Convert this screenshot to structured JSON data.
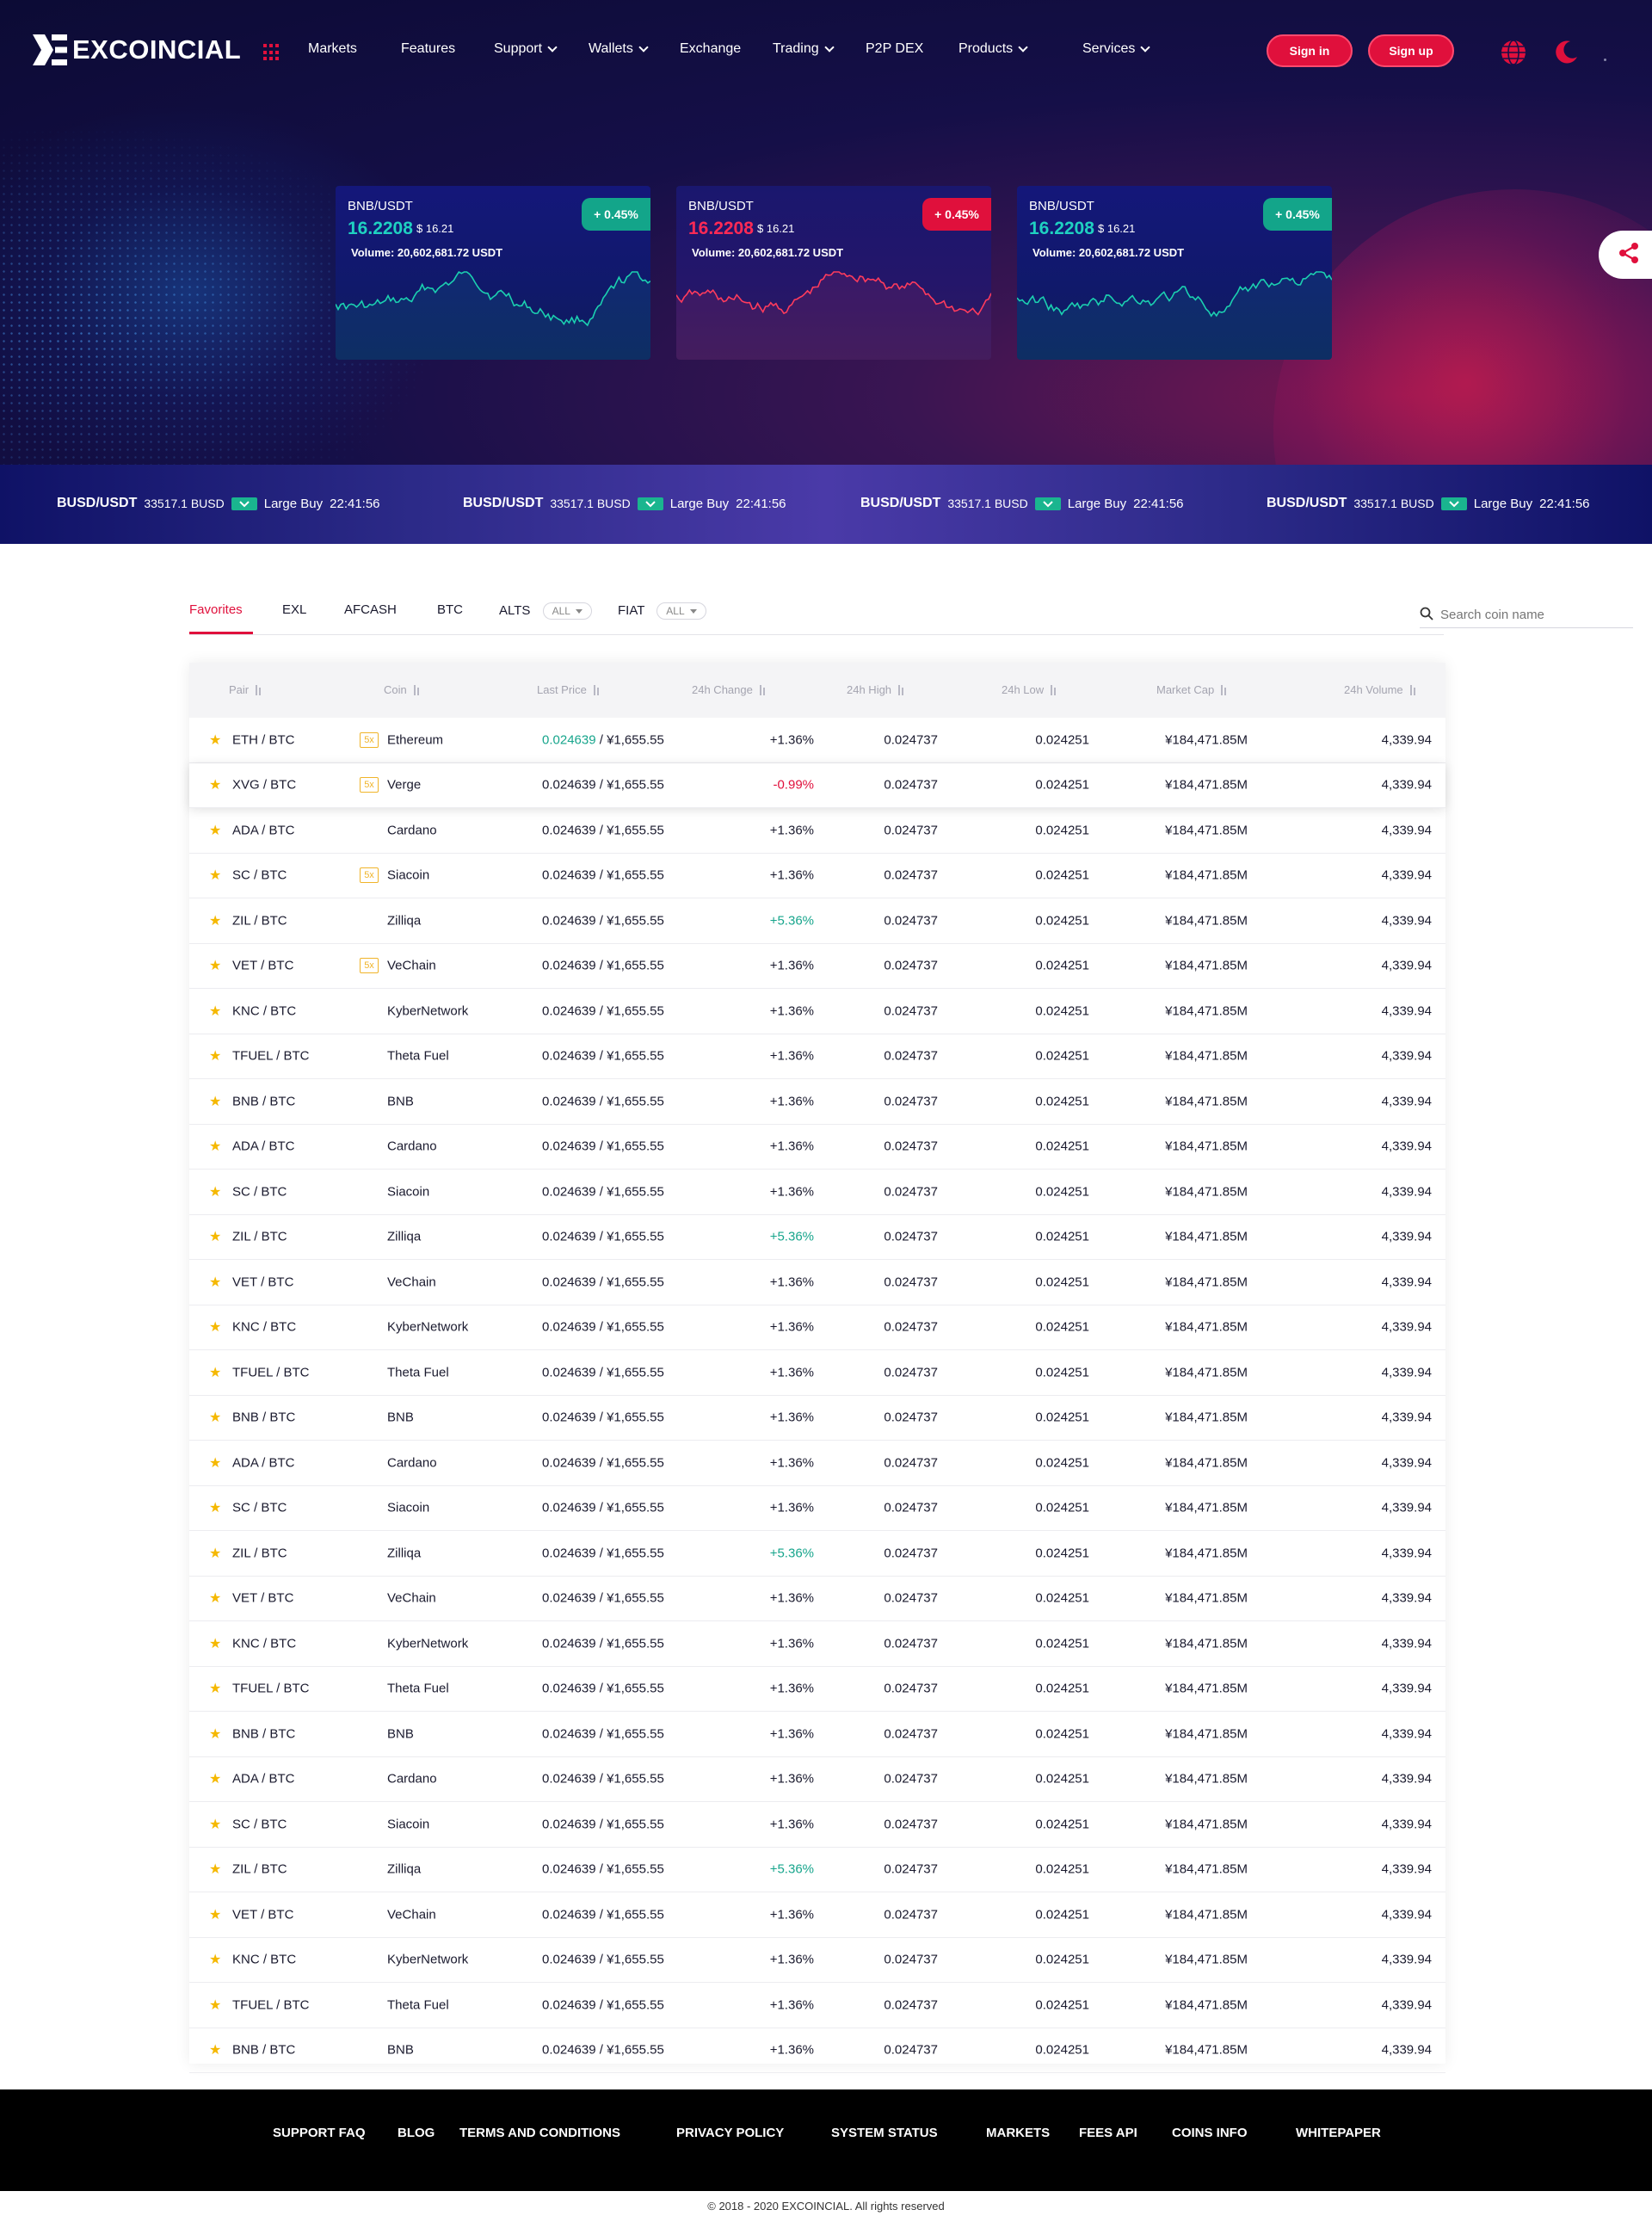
{
  "brand": {
    "name": "EXCOINCIAL"
  },
  "nav": {
    "items": [
      {
        "label": "Markets",
        "dropdown": false
      },
      {
        "label": "Features",
        "dropdown": false
      },
      {
        "label": "Support",
        "dropdown": true
      },
      {
        "label": "Wallets",
        "dropdown": true
      },
      {
        "label": "Exchange",
        "dropdown": false
      },
      {
        "label": "Trading",
        "dropdown": true
      },
      {
        "label": "P2P DEX",
        "dropdown": false
      },
      {
        "label": "Products",
        "dropdown": true
      },
      {
        "label": "Services",
        "dropdown": true
      }
    ],
    "sign_in": "Sign in",
    "sign_up": "Sign up"
  },
  "cards": [
    {
      "pair": "BNB/USDT",
      "price": "16.2208",
      "usd": "$ 16.21",
      "volume": "Volume: 20,602,681.72 USDT",
      "change": "+ 0.45%",
      "trend": "up",
      "price_color": "#1fd1c1",
      "badge_color": "#13a58a"
    },
    {
      "pair": "BNB/USDT",
      "price": "16.2208",
      "usd": "$ 16.21",
      "volume": "Volume: 20,602,681.72 USDT",
      "change": "+ 0.45%",
      "trend": "down",
      "price_color": "#ff2a55",
      "badge_color": "#e0103c"
    },
    {
      "pair": "BNB/USDT",
      "price": "16.2208",
      "usd": "$ 16.21",
      "volume": "Volume: 20,602,681.72 USDT",
      "change": "+ 0.45%",
      "trend": "up",
      "price_color": "#1fd1c1",
      "badge_color": "#13a58a"
    }
  ],
  "marquee": [
    {
      "pair": "BUSD/USDT",
      "value": "33517.1 BUSD",
      "type": "Large Buy",
      "time": "22:41:56"
    },
    {
      "pair": "BUSD/USDT",
      "value": "33517.1 BUSD",
      "type": "Large Buy",
      "time": "22:41:56"
    },
    {
      "pair": "BUSD/USDT",
      "value": "33517.1 BUSD",
      "type": "Large Buy",
      "time": "22:41:56"
    },
    {
      "pair": "BUSD/USDT",
      "value": "33517.1 BUSD",
      "type": "Large Buy",
      "time": "22:41:56"
    }
  ],
  "tabs": {
    "favorites": "Favorites",
    "exl": "EXL",
    "afcash": "AFCASH",
    "btc": "BTC",
    "alts": "ALTS",
    "fiat": "FIAT",
    "all": "ALL"
  },
  "search": {
    "placeholder": "Search coin name"
  },
  "table": {
    "headers": [
      "Pair",
      "Coin",
      "Last Price",
      "24h Change",
      "24h High",
      "24h Low",
      "Market Cap",
      "24h Volume"
    ],
    "rows": [
      {
        "pair": "ETH / BTC",
        "lev": "5x",
        "coin": "Ethereum",
        "last_hi": "0.024639",
        "last_rest": " / ¥1,655.55",
        "change": "+1.36%",
        "chg": "pos",
        "high": "0.024737",
        "low": "0.024251",
        "cap": "¥184,471.85M",
        "vol": "4,339.94"
      },
      {
        "pair": "XVG / BTC",
        "lev": "5x",
        "coin": "Verge",
        "last_hi": "",
        "last_rest": "0.024639 / ¥1,655.55",
        "change": "-0.99%",
        "chg": "red",
        "high": "0.024737",
        "low": "0.024251",
        "cap": "¥184,471.85M",
        "vol": "4,339.94",
        "hl": true
      },
      {
        "pair": "ADA / BTC",
        "lev": "",
        "coin": "Cardano",
        "last_hi": "",
        "last_rest": "0.024639 / ¥1,655.55",
        "change": "+1.36%",
        "chg": "pos",
        "high": "0.024737",
        "low": "0.024251",
        "cap": "¥184,471.85M",
        "vol": "4,339.94"
      },
      {
        "pair": "SC / BTC",
        "lev": "5x",
        "coin": "Siacoin",
        "last_hi": "",
        "last_rest": "0.024639 / ¥1,655.55",
        "change": "+1.36%",
        "chg": "pos",
        "high": "0.024737",
        "low": "0.024251",
        "cap": "¥184,471.85M",
        "vol": "4,339.94"
      },
      {
        "pair": "ZIL / BTC",
        "lev": "",
        "coin": "Zilliqa",
        "last_hi": "",
        "last_rest": "0.024639 / ¥1,655.55",
        "change": "+5.36%",
        "chg": "green",
        "high": "0.024737",
        "low": "0.024251",
        "cap": "¥184,471.85M",
        "vol": "4,339.94"
      },
      {
        "pair": "VET / BTC",
        "lev": "5x",
        "coin": "VeChain",
        "last_hi": "",
        "last_rest": "0.024639 / ¥1,655.55",
        "change": "+1.36%",
        "chg": "pos",
        "high": "0.024737",
        "low": "0.024251",
        "cap": "¥184,471.85M",
        "vol": "4,339.94"
      },
      {
        "pair": "KNC / BTC",
        "lev": "",
        "coin": "KyberNetwork",
        "last_hi": "",
        "last_rest": "0.024639 / ¥1,655.55",
        "change": "+1.36%",
        "chg": "pos",
        "high": "0.024737",
        "low": "0.024251",
        "cap": "¥184,471.85M",
        "vol": "4,339.94"
      },
      {
        "pair": "TFUEL / BTC",
        "lev": "",
        "coin": "Theta Fuel",
        "last_hi": "",
        "last_rest": "0.024639 / ¥1,655.55",
        "change": "+1.36%",
        "chg": "pos",
        "high": "0.024737",
        "low": "0.024251",
        "cap": "¥184,471.85M",
        "vol": "4,339.94"
      },
      {
        "pair": "BNB / BTC",
        "lev": "",
        "coin": "BNB",
        "last_hi": "",
        "last_rest": "0.024639 / ¥1,655.55",
        "change": "+1.36%",
        "chg": "pos",
        "high": "0.024737",
        "low": "0.024251",
        "cap": "¥184,471.85M",
        "vol": "4,339.94"
      },
      {
        "pair": "ADA / BTC",
        "lev": "",
        "coin": "Cardano",
        "last_hi": "",
        "last_rest": "0.024639 / ¥1,655.55",
        "change": "+1.36%",
        "chg": "pos",
        "high": "0.024737",
        "low": "0.024251",
        "cap": "¥184,471.85M",
        "vol": "4,339.94"
      },
      {
        "pair": "SC / BTC",
        "lev": "",
        "coin": "Siacoin",
        "last_hi": "",
        "last_rest": "0.024639 / ¥1,655.55",
        "change": "+1.36%",
        "chg": "pos",
        "high": "0.024737",
        "low": "0.024251",
        "cap": "¥184,471.85M",
        "vol": "4,339.94"
      },
      {
        "pair": "ZIL / BTC",
        "lev": "",
        "coin": "Zilliqa",
        "last_hi": "",
        "last_rest": "0.024639 / ¥1,655.55",
        "change": "+5.36%",
        "chg": "green",
        "high": "0.024737",
        "low": "0.024251",
        "cap": "¥184,471.85M",
        "vol": "4,339.94"
      },
      {
        "pair": "VET / BTC",
        "lev": "",
        "coin": "VeChain",
        "last_hi": "",
        "last_rest": "0.024639 / ¥1,655.55",
        "change": "+1.36%",
        "chg": "pos",
        "high": "0.024737",
        "low": "0.024251",
        "cap": "¥184,471.85M",
        "vol": "4,339.94"
      },
      {
        "pair": "KNC / BTC",
        "lev": "",
        "coin": "KyberNetwork",
        "last_hi": "",
        "last_rest": "0.024639 / ¥1,655.55",
        "change": "+1.36%",
        "chg": "pos",
        "high": "0.024737",
        "low": "0.024251",
        "cap": "¥184,471.85M",
        "vol": "4,339.94"
      },
      {
        "pair": "TFUEL / BTC",
        "lev": "",
        "coin": "Theta Fuel",
        "last_hi": "",
        "last_rest": "0.024639 / ¥1,655.55",
        "change": "+1.36%",
        "chg": "pos",
        "high": "0.024737",
        "low": "0.024251",
        "cap": "¥184,471.85M",
        "vol": "4,339.94"
      },
      {
        "pair": "BNB / BTC",
        "lev": "",
        "coin": "BNB",
        "last_hi": "",
        "last_rest": "0.024639 / ¥1,655.55",
        "change": "+1.36%",
        "chg": "pos",
        "high": "0.024737",
        "low": "0.024251",
        "cap": "¥184,471.85M",
        "vol": "4,339.94"
      },
      {
        "pair": "ADA / BTC",
        "lev": "",
        "coin": "Cardano",
        "last_hi": "",
        "last_rest": "0.024639 / ¥1,655.55",
        "change": "+1.36%",
        "chg": "pos",
        "high": "0.024737",
        "low": "0.024251",
        "cap": "¥184,471.85M",
        "vol": "4,339.94"
      },
      {
        "pair": "SC / BTC",
        "lev": "",
        "coin": "Siacoin",
        "last_hi": "",
        "last_rest": "0.024639 / ¥1,655.55",
        "change": "+1.36%",
        "chg": "pos",
        "high": "0.024737",
        "low": "0.024251",
        "cap": "¥184,471.85M",
        "vol": "4,339.94"
      },
      {
        "pair": "ZIL / BTC",
        "lev": "",
        "coin": "Zilliqa",
        "last_hi": "",
        "last_rest": "0.024639 / ¥1,655.55",
        "change": "+5.36%",
        "chg": "green",
        "high": "0.024737",
        "low": "0.024251",
        "cap": "¥184,471.85M",
        "vol": "4,339.94"
      },
      {
        "pair": "VET / BTC",
        "lev": "",
        "coin": "VeChain",
        "last_hi": "",
        "last_rest": "0.024639 / ¥1,655.55",
        "change": "+1.36%",
        "chg": "pos",
        "high": "0.024737",
        "low": "0.024251",
        "cap": "¥184,471.85M",
        "vol": "4,339.94"
      },
      {
        "pair": "KNC / BTC",
        "lev": "",
        "coin": "KyberNetwork",
        "last_hi": "",
        "last_rest": "0.024639 / ¥1,655.55",
        "change": "+1.36%",
        "chg": "pos",
        "high": "0.024737",
        "low": "0.024251",
        "cap": "¥184,471.85M",
        "vol": "4,339.94"
      },
      {
        "pair": "TFUEL / BTC",
        "lev": "",
        "coin": "Theta Fuel",
        "last_hi": "",
        "last_rest": "0.024639 / ¥1,655.55",
        "change": "+1.36%",
        "chg": "pos",
        "high": "0.024737",
        "low": "0.024251",
        "cap": "¥184,471.85M",
        "vol": "4,339.94"
      },
      {
        "pair": "BNB / BTC",
        "lev": "",
        "coin": "BNB",
        "last_hi": "",
        "last_rest": "0.024639 / ¥1,655.55",
        "change": "+1.36%",
        "chg": "pos",
        "high": "0.024737",
        "low": "0.024251",
        "cap": "¥184,471.85M",
        "vol": "4,339.94"
      },
      {
        "pair": "ADA / BTC",
        "lev": "",
        "coin": "Cardano",
        "last_hi": "",
        "last_rest": "0.024639 / ¥1,655.55",
        "change": "+1.36%",
        "chg": "pos",
        "high": "0.024737",
        "low": "0.024251",
        "cap": "¥184,471.85M",
        "vol": "4,339.94"
      },
      {
        "pair": "SC / BTC",
        "lev": "",
        "coin": "Siacoin",
        "last_hi": "",
        "last_rest": "0.024639 / ¥1,655.55",
        "change": "+1.36%",
        "chg": "pos",
        "high": "0.024737",
        "low": "0.024251",
        "cap": "¥184,471.85M",
        "vol": "4,339.94"
      },
      {
        "pair": "ZIL / BTC",
        "lev": "",
        "coin": "Zilliqa",
        "last_hi": "",
        "last_rest": "0.024639 / ¥1,655.55",
        "change": "+5.36%",
        "chg": "green",
        "high": "0.024737",
        "low": "0.024251",
        "cap": "¥184,471.85M",
        "vol": "4,339.94"
      },
      {
        "pair": "VET / BTC",
        "lev": "",
        "coin": "VeChain",
        "last_hi": "",
        "last_rest": "0.024639 / ¥1,655.55",
        "change": "+1.36%",
        "chg": "pos",
        "high": "0.024737",
        "low": "0.024251",
        "cap": "¥184,471.85M",
        "vol": "4,339.94"
      },
      {
        "pair": "KNC / BTC",
        "lev": "",
        "coin": "KyberNetwork",
        "last_hi": "",
        "last_rest": "0.024639 / ¥1,655.55",
        "change": "+1.36%",
        "chg": "pos",
        "high": "0.024737",
        "low": "0.024251",
        "cap": "¥184,471.85M",
        "vol": "4,339.94"
      },
      {
        "pair": "TFUEL / BTC",
        "lev": "",
        "coin": "Theta Fuel",
        "last_hi": "",
        "last_rest": "0.024639 / ¥1,655.55",
        "change": "+1.36%",
        "chg": "pos",
        "high": "0.024737",
        "low": "0.024251",
        "cap": "¥184,471.85M",
        "vol": "4,339.94"
      },
      {
        "pair": "BNB / BTC",
        "lev": "",
        "coin": "BNB",
        "last_hi": "",
        "last_rest": "0.024639 / ¥1,655.55",
        "change": "+1.36%",
        "chg": "pos",
        "high": "0.024737",
        "low": "0.024251",
        "cap": "¥184,471.85M",
        "vol": "4,339.94"
      }
    ]
  },
  "footer": {
    "links": [
      "SUPPORT FAQ",
      "BLOG",
      "TERMS AND CONDITIONS",
      "PRIVACY POLICY",
      "SYSTEM STATUS",
      "MARKETS",
      "FEES API",
      "COINS INFO",
      "WHITEPAPER"
    ],
    "copyright": "© 2018 - 2020 EXCOINCIAL. All rights reserved"
  },
  "colors": {
    "accent": "#e0103c",
    "up": "#17a58c",
    "down": "#e0103c",
    "star": "#f5b800"
  }
}
